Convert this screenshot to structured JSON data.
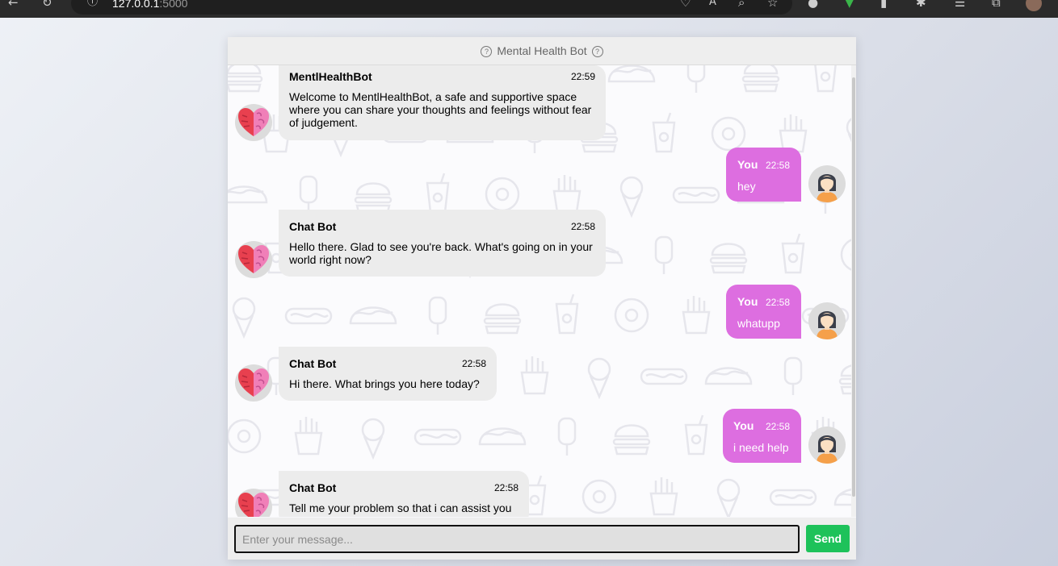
{
  "browser": {
    "url_host": "127.0.0.1",
    "url_port": ":5000"
  },
  "header": {
    "title": "Mental Health Bot",
    "left_icon": "help-circle-icon",
    "right_icon": "help-circle-icon"
  },
  "colors": {
    "user_bubble": "#dd6ee0",
    "bot_bubble": "#ececec",
    "send_button": "#1ec25a"
  },
  "messages": [
    {
      "sender": "MentlHealthBot",
      "role": "bot",
      "time": "22:59",
      "text": "Welcome to MentlHealthBot, a safe and supportive space where you can share your thoughts and feelings without fear of judgement.",
      "avatar": "heart-brain-icon"
    },
    {
      "sender": "You",
      "role": "user",
      "time": "22:58",
      "text": "hey",
      "avatar": "woman-avatar-icon"
    },
    {
      "sender": "Chat Bot",
      "role": "bot",
      "time": "22:58",
      "text": "Hello there. Glad to see you're back. What's going on in your world right now?",
      "avatar": "heart-brain-icon"
    },
    {
      "sender": "You",
      "role": "user",
      "time": "22:58",
      "text": "whatupp",
      "avatar": "woman-avatar-icon"
    },
    {
      "sender": "Chat Bot",
      "role": "bot",
      "time": "22:58",
      "text": "Hi there. What brings you here today?",
      "avatar": "heart-brain-icon"
    },
    {
      "sender": "You",
      "role": "user",
      "time": "22:58",
      "text": "i need help",
      "avatar": "woman-avatar-icon"
    },
    {
      "sender": "Chat Bot",
      "role": "bot",
      "time": "22:58",
      "text": "Tell me your problem so that i can assist you",
      "avatar": "heart-brain-icon"
    }
  ],
  "input": {
    "placeholder": "Enter your message...",
    "value": ""
  },
  "send_label": "Send"
}
